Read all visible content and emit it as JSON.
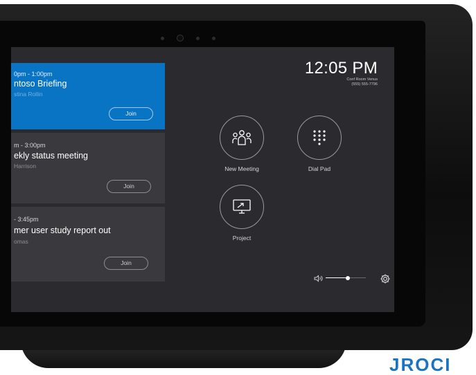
{
  "meetings": [
    {
      "time": "0pm - 1:00pm",
      "title": "ntoso Briefing",
      "organizer": "stina Rollin",
      "join_label": "Join",
      "active": true
    },
    {
      "time": "m - 3:00pm",
      "title": "ekly status meeting",
      "organizer": "Harrison",
      "join_label": "Join",
      "active": false
    },
    {
      "time": "- 3:45pm",
      "title": "mer user study report out",
      "organizer": "omas",
      "join_label": "Join",
      "active": false
    }
  ],
  "clock": {
    "time": "12:05 PM",
    "room": "Conf Room Venus",
    "phone": "(555) 555-7796"
  },
  "actions": {
    "new_meeting": "New Meeting",
    "dial_pad": "Dial Pad",
    "project": "Project"
  },
  "volume": {
    "level": 0.55
  },
  "brand_text": "JROCI",
  "colors": {
    "accent": "#0a74c4",
    "screen_bg": "#2b2b2f",
    "card_bg": "#3a3a3e"
  },
  "icons": [
    "people-icon",
    "dialpad-icon",
    "project-screen-icon",
    "speaker-icon",
    "gear-icon"
  ]
}
